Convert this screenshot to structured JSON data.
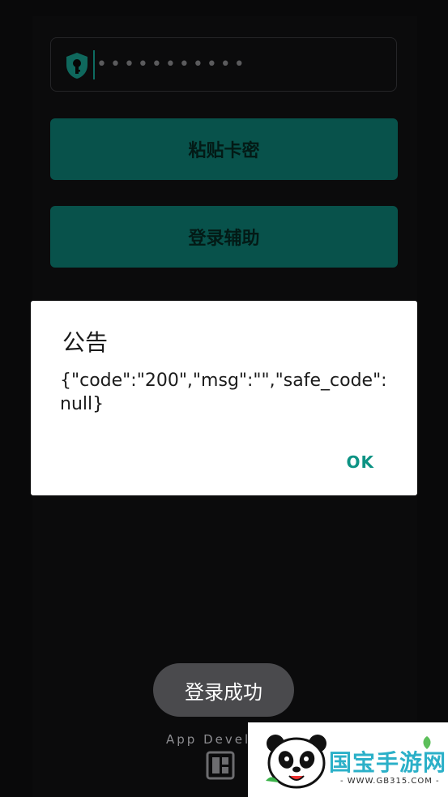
{
  "login": {
    "password_masked": "•••••••••••",
    "paste_button": "粘贴卡密",
    "login_button": "登录辅助"
  },
  "dialog": {
    "title": "公告",
    "message": "{\"code\":\"200\",\"msg\":\"\",\"safe_code\":null}",
    "ok_label": "OK"
  },
  "toast": {
    "text": "登录成功"
  },
  "footer": {
    "text": "App Devel"
  },
  "watermark": {
    "brand": "国宝手游网",
    "url": "- WWW.GB315.COM -"
  },
  "colors": {
    "accent": "#0d7e73",
    "ok": "#0d9384",
    "background": "#0e0e10"
  }
}
